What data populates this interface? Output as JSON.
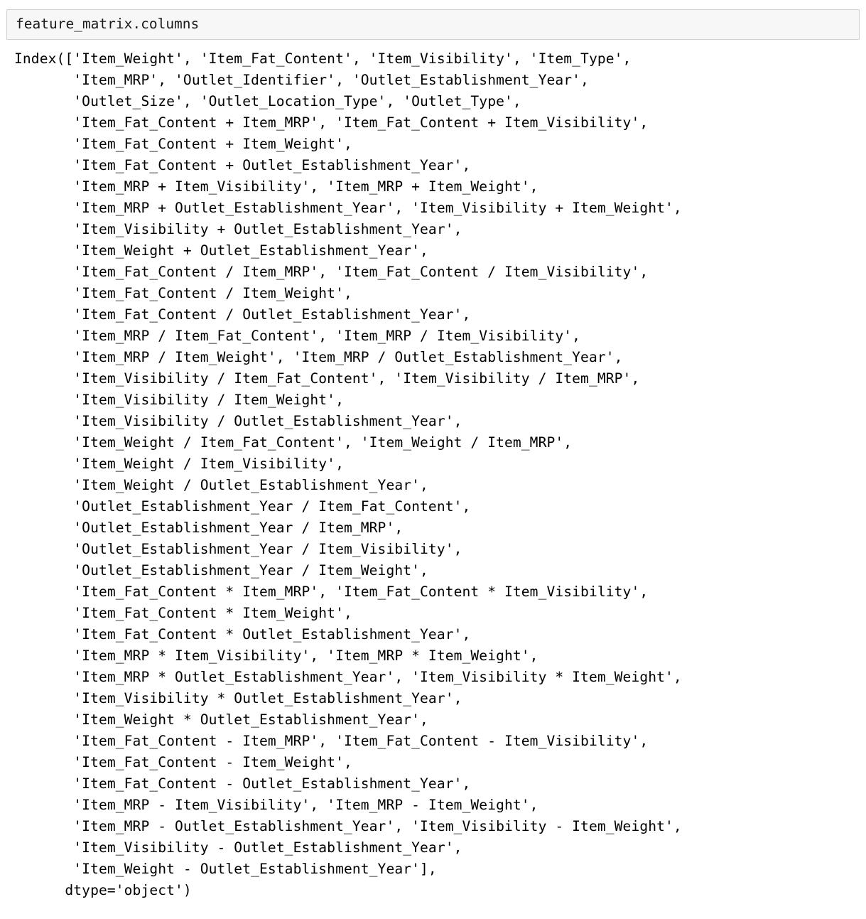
{
  "cell": {
    "input_code": "feature_matrix.columns",
    "background_color": "#f7f7f7",
    "border_color": "#cfcfcf"
  },
  "output": {
    "text_color": "#000000",
    "dtype_line": "dtype='object')",
    "prefix": "Index([",
    "lines": [
      "Index(['Item_Weight', 'Item_Fat_Content', 'Item_Visibility', 'Item_Type',",
      "       'Item_MRP', 'Outlet_Identifier', 'Outlet_Establishment_Year',",
      "       'Outlet_Size', 'Outlet_Location_Type', 'Outlet_Type',",
      "       'Item_Fat_Content + Item_MRP', 'Item_Fat_Content + Item_Visibility',",
      "       'Item_Fat_Content + Item_Weight',",
      "       'Item_Fat_Content + Outlet_Establishment_Year',",
      "       'Item_MRP + Item_Visibility', 'Item_MRP + Item_Weight',",
      "       'Item_MRP + Outlet_Establishment_Year', 'Item_Visibility + Item_Weight',",
      "       'Item_Visibility + Outlet_Establishment_Year',",
      "       'Item_Weight + Outlet_Establishment_Year',",
      "       'Item_Fat_Content / Item_MRP', 'Item_Fat_Content / Item_Visibility',",
      "       'Item_Fat_Content / Item_Weight',",
      "       'Item_Fat_Content / Outlet_Establishment_Year',",
      "       'Item_MRP / Item_Fat_Content', 'Item_MRP / Item_Visibility',",
      "       'Item_MRP / Item_Weight', 'Item_MRP / Outlet_Establishment_Year',",
      "       'Item_Visibility / Item_Fat_Content', 'Item_Visibility / Item_MRP',",
      "       'Item_Visibility / Item_Weight',",
      "       'Item_Visibility / Outlet_Establishment_Year',",
      "       'Item_Weight / Item_Fat_Content', 'Item_Weight / Item_MRP',",
      "       'Item_Weight / Item_Visibility',",
      "       'Item_Weight / Outlet_Establishment_Year',",
      "       'Outlet_Establishment_Year / Item_Fat_Content',",
      "       'Outlet_Establishment_Year / Item_MRP',",
      "       'Outlet_Establishment_Year / Item_Visibility',",
      "       'Outlet_Establishment_Year / Item_Weight',",
      "       'Item_Fat_Content * Item_MRP', 'Item_Fat_Content * Item_Visibility',",
      "       'Item_Fat_Content * Item_Weight',",
      "       'Item_Fat_Content * Outlet_Establishment_Year',",
      "       'Item_MRP * Item_Visibility', 'Item_MRP * Item_Weight',",
      "       'Item_MRP * Outlet_Establishment_Year', 'Item_Visibility * Item_Weight',",
      "       'Item_Visibility * Outlet_Establishment_Year',",
      "       'Item_Weight * Outlet_Establishment_Year',",
      "       'Item_Fat_Content - Item_MRP', 'Item_Fat_Content - Item_Visibility',",
      "       'Item_Fat_Content - Item_Weight',",
      "       'Item_Fat_Content - Outlet_Establishment_Year',",
      "       'Item_MRP - Item_Visibility', 'Item_MRP - Item_Weight',",
      "       'Item_MRP - Outlet_Establishment_Year', 'Item_Visibility - Item_Weight',",
      "       'Item_Visibility - Outlet_Establishment_Year',",
      "       'Item_Weight - Outlet_Establishment_Year'],",
      "      dtype='object')"
    ],
    "full_text": "Index(['Item_Weight', 'Item_Fat_Content', 'Item_Visibility', 'Item_Type',\n       'Item_MRP', 'Outlet_Identifier', 'Outlet_Establishment_Year',\n       'Outlet_Size', 'Outlet_Location_Type', 'Outlet_Type',\n       'Item_Fat_Content + Item_MRP', 'Item_Fat_Content + Item_Visibility',\n       'Item_Fat_Content + Item_Weight',\n       'Item_Fat_Content + Outlet_Establishment_Year',\n       'Item_MRP + Item_Visibility', 'Item_MRP + Item_Weight',\n       'Item_MRP + Outlet_Establishment_Year', 'Item_Visibility + Item_Weight',\n       'Item_Visibility + Outlet_Establishment_Year',\n       'Item_Weight + Outlet_Establishment_Year',\n       'Item_Fat_Content / Item_MRP', 'Item_Fat_Content / Item_Visibility',\n       'Item_Fat_Content / Item_Weight',\n       'Item_Fat_Content / Outlet_Establishment_Year',\n       'Item_MRP / Item_Fat_Content', 'Item_MRP / Item_Visibility',\n       'Item_MRP / Item_Weight', 'Item_MRP / Outlet_Establishment_Year',\n       'Item_Visibility / Item_Fat_Content', 'Item_Visibility / Item_MRP',\n       'Item_Visibility / Item_Weight',\n       'Item_Visibility / Outlet_Establishment_Year',\n       'Item_Weight / Item_Fat_Content', 'Item_Weight / Item_MRP',\n       'Item_Weight / Item_Visibility',\n       'Item_Weight / Outlet_Establishment_Year',\n       'Outlet_Establishment_Year / Item_Fat_Content',\n       'Outlet_Establishment_Year / Item_MRP',\n       'Outlet_Establishment_Year / Item_Visibility',\n       'Outlet_Establishment_Year / Item_Weight',\n       'Item_Fat_Content * Item_MRP', 'Item_Fat_Content * Item_Visibility',\n       'Item_Fat_Content * Item_Weight',\n       'Item_Fat_Content * Outlet_Establishment_Year',\n       'Item_MRP * Item_Visibility', 'Item_MRP * Item_Weight',\n       'Item_MRP * Outlet_Establishment_Year', 'Item_Visibility * Item_Weight',\n       'Item_Visibility * Outlet_Establishment_Year',\n       'Item_Weight * Outlet_Establishment_Year',\n       'Item_Fat_Content - Item_MRP', 'Item_Fat_Content - Item_Visibility',\n       'Item_Fat_Content - Item_Weight',\n       'Item_Fat_Content - Outlet_Establishment_Year',\n       'Item_MRP - Item_Visibility', 'Item_MRP - Item_Weight',\n       'Item_MRP - Outlet_Establishment_Year', 'Item_Visibility - Item_Weight',\n       'Item_Visibility - Outlet_Establishment_Year',\n       'Item_Weight - Outlet_Establishment_Year'],\n      dtype='object')",
    "column_names": [
      "Item_Weight",
      "Item_Fat_Content",
      "Item_Visibility",
      "Item_Type",
      "Item_MRP",
      "Outlet_Identifier",
      "Outlet_Establishment_Year",
      "Outlet_Size",
      "Outlet_Location_Type",
      "Outlet_Type",
      "Item_Fat_Content + Item_MRP",
      "Item_Fat_Content + Item_Visibility",
      "Item_Fat_Content + Item_Weight",
      "Item_Fat_Content + Outlet_Establishment_Year",
      "Item_MRP + Item_Visibility",
      "Item_MRP + Item_Weight",
      "Item_MRP + Outlet_Establishment_Year",
      "Item_Visibility + Item_Weight",
      "Item_Visibility + Outlet_Establishment_Year",
      "Item_Weight + Outlet_Establishment_Year",
      "Item_Fat_Content / Item_MRP",
      "Item_Fat_Content / Item_Visibility",
      "Item_Fat_Content / Item_Weight",
      "Item_Fat_Content / Outlet_Establishment_Year",
      "Item_MRP / Item_Fat_Content",
      "Item_MRP / Item_Visibility",
      "Item_MRP / Item_Weight",
      "Item_MRP / Outlet_Establishment_Year",
      "Item_Visibility / Item_Fat_Content",
      "Item_Visibility / Item_MRP",
      "Item_Visibility / Item_Weight",
      "Item_Visibility / Outlet_Establishment_Year",
      "Item_Weight / Item_Fat_Content",
      "Item_Weight / Item_MRP",
      "Item_Weight / Item_Visibility",
      "Item_Weight / Outlet_Establishment_Year",
      "Outlet_Establishment_Year / Item_Fat_Content",
      "Outlet_Establishment_Year / Item_MRP",
      "Outlet_Establishment_Year / Item_Visibility",
      "Outlet_Establishment_Year / Item_Weight",
      "Item_Fat_Content * Item_MRP",
      "Item_Fat_Content * Item_Visibility",
      "Item_Fat_Content * Item_Weight",
      "Item_Fat_Content * Outlet_Establishment_Year",
      "Item_MRP * Item_Visibility",
      "Item_MRP * Item_Weight",
      "Item_MRP * Outlet_Establishment_Year",
      "Item_Visibility * Item_Weight",
      "Item_Visibility * Outlet_Establishment_Year",
      "Item_Weight * Outlet_Establishment_Year",
      "Item_Fat_Content - Item_MRP",
      "Item_Fat_Content - Item_Visibility",
      "Item_Fat_Content - Item_Weight",
      "Item_Fat_Content - Outlet_Establishment_Year",
      "Item_MRP - Item_Visibility",
      "Item_MRP - Item_Weight",
      "Item_MRP - Outlet_Establishment_Year",
      "Item_Visibility - Item_Weight",
      "Item_Visibility - Outlet_Establishment_Year",
      "Item_Weight - Outlet_Establishment_Year"
    ]
  }
}
